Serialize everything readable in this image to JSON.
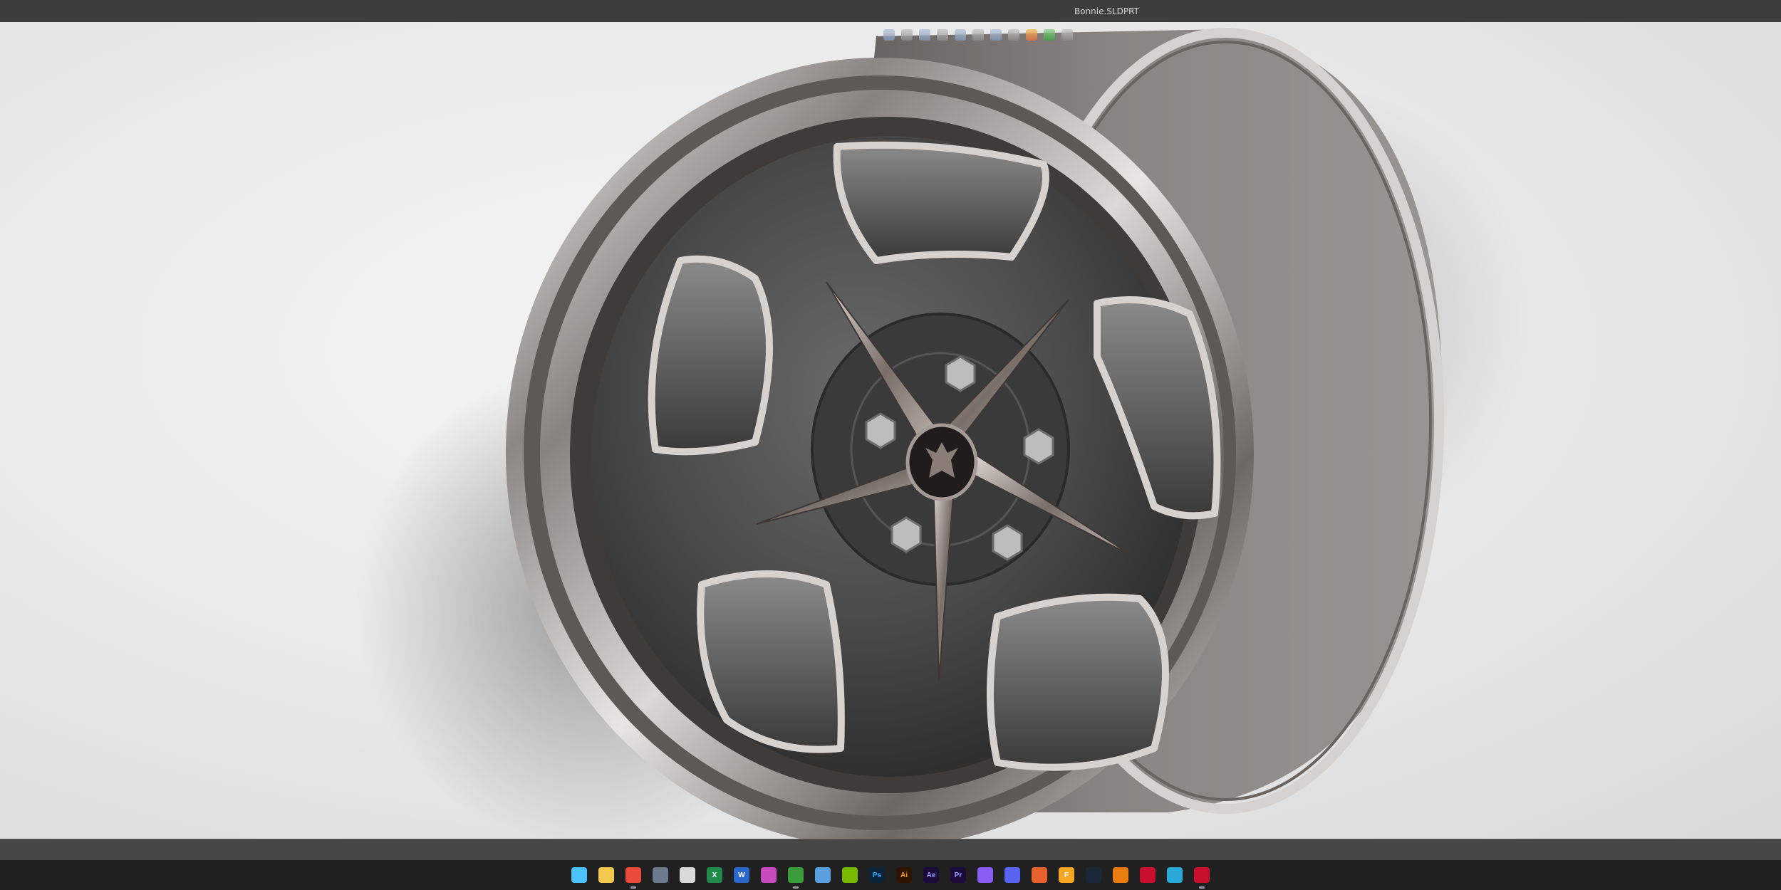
{
  "window": {
    "title": "Bonnie.SLDPRT"
  },
  "taskbar": {
    "items": [
      {
        "name": "start-button",
        "icon": "windows-logo-icon",
        "glyph": "",
        "color": "#4cc2ff",
        "active": false
      },
      {
        "name": "file-explorer",
        "icon": "folder-icon",
        "glyph": "",
        "color": "#f2c94c",
        "active": false
      },
      {
        "name": "chrome",
        "icon": "chrome-icon",
        "glyph": "",
        "color": "#e84b3c",
        "active": true
      },
      {
        "name": "calculator",
        "icon": "calculator-icon",
        "glyph": "",
        "color": "#6b7a8c",
        "active": false
      },
      {
        "name": "calendar-app",
        "icon": "calendar-icon",
        "glyph": "",
        "color": "#d9d9d9",
        "active": false
      },
      {
        "name": "excel",
        "icon": "excel-icon",
        "glyph": "X",
        "color": "#1f8a4c",
        "active": false
      },
      {
        "name": "word",
        "icon": "word-icon",
        "glyph": "W",
        "color": "#2b67c9",
        "active": false
      },
      {
        "name": "photos",
        "icon": "photos-icon",
        "glyph": "",
        "color": "#c84bbd",
        "active": false
      },
      {
        "name": "xbox",
        "icon": "xbox-icon",
        "glyph": "",
        "color": "#3a9c3a",
        "active": true
      },
      {
        "name": "notepad",
        "icon": "notepad-icon",
        "glyph": "",
        "color": "#5aa0e0",
        "active": false
      },
      {
        "name": "nvidia",
        "icon": "nvidia-icon",
        "glyph": "",
        "color": "#76b900",
        "active": false
      },
      {
        "name": "photoshop",
        "icon": "photoshop-icon",
        "glyph": "Ps",
        "color": "#0b2438",
        "text": "#31a8ff",
        "active": false
      },
      {
        "name": "illustrator",
        "icon": "illustrator-icon",
        "glyph": "Ai",
        "color": "#2e1300",
        "text": "#ff9a00",
        "active": false
      },
      {
        "name": "after-effects",
        "icon": "after-effects-icon",
        "glyph": "Ae",
        "color": "#1a0b3a",
        "text": "#9999ff",
        "active": false
      },
      {
        "name": "premiere",
        "icon": "premiere-icon",
        "glyph": "Pr",
        "color": "#1a0b3a",
        "text": "#9999ff",
        "active": false
      },
      {
        "name": "messenger",
        "icon": "messenger-icon",
        "glyph": "",
        "color": "#8a5cf6",
        "active": false
      },
      {
        "name": "discord",
        "icon": "discord-icon",
        "glyph": "",
        "color": "#5865f2",
        "active": false
      },
      {
        "name": "blender-like",
        "icon": "orange-circle-icon",
        "glyph": "",
        "color": "#e8612c",
        "active": false
      },
      {
        "name": "fusion",
        "icon": "fusion-icon",
        "glyph": "F",
        "color": "#f5a623",
        "active": false
      },
      {
        "name": "steam",
        "icon": "steam-icon",
        "glyph": "",
        "color": "#1b2838",
        "active": false
      },
      {
        "name": "blender",
        "icon": "blender-icon",
        "glyph": "",
        "color": "#e87d0d",
        "active": false
      },
      {
        "name": "solidworks-2026-a",
        "icon": "solidworks-icon",
        "glyph": "",
        "color": "#c8102e",
        "active": false
      },
      {
        "name": "cube-app",
        "icon": "cube-icon",
        "glyph": "",
        "color": "#2aa8d8",
        "active": false
      },
      {
        "name": "solidworks-2026-b",
        "icon": "solidworks-icon",
        "glyph": "",
        "color": "#c8102e",
        "active": true
      }
    ]
  },
  "colors": {
    "titlebar": "#3d3d3d",
    "statusbar": "#474747",
    "taskbar": "#202020",
    "wheel_face": "#4a4a4a",
    "chrome": "#c9c5c2"
  }
}
